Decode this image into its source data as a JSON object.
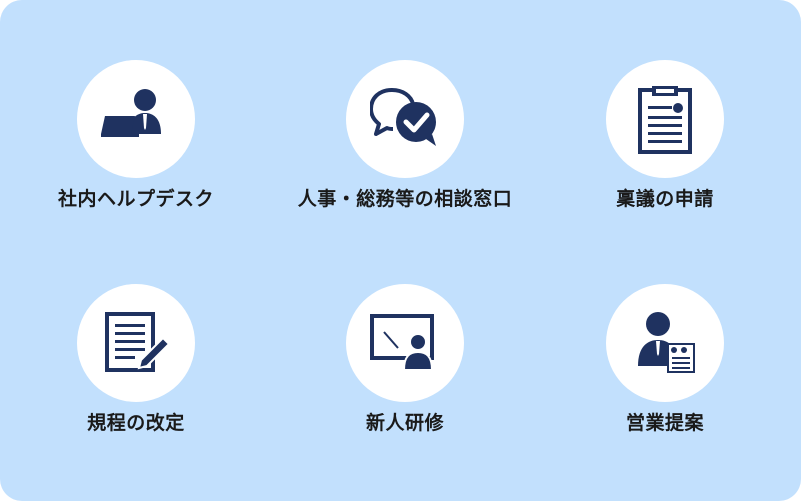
{
  "colors": {
    "background": "#c2e0fd",
    "icon": "#1f3260",
    "circle": "#ffffff",
    "text": "#1a1a1a"
  },
  "services": [
    {
      "label": "社内ヘルプデスク",
      "icon": "person-at-laptop-icon"
    },
    {
      "label": "人事・総務等の相談窓口",
      "icon": "chat-bubbles-check-icon"
    },
    {
      "label": "稟議の申請",
      "icon": "clipboard-icon"
    },
    {
      "label": "規程の改定",
      "icon": "document-pen-icon"
    },
    {
      "label": "新人研修",
      "icon": "presentation-board-icon"
    },
    {
      "label": "営業提案",
      "icon": "person-with-document-icon"
    }
  ]
}
